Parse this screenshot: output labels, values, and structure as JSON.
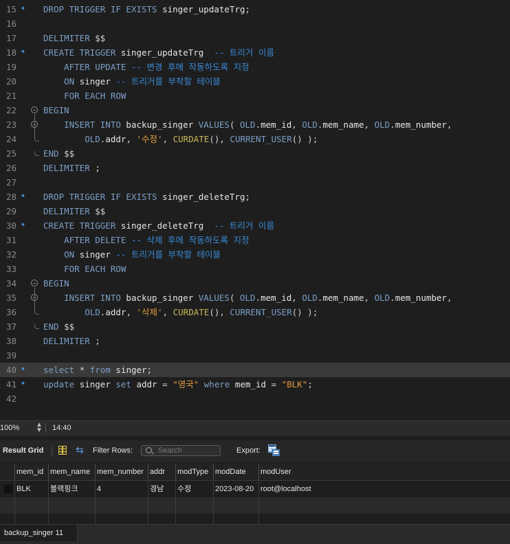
{
  "editor": {
    "lines": [
      {
        "n": "15",
        "dot": true,
        "parts": [
          [
            "kw",
            "DROP TRIGGER IF EXISTS "
          ],
          [
            "id",
            "singer_updateTrg"
          ],
          [
            "op",
            ";"
          ]
        ]
      },
      {
        "n": "16",
        "parts": []
      },
      {
        "n": "17",
        "parts": [
          [
            "kw",
            "DELIMITER "
          ],
          [
            "op",
            "$$"
          ]
        ]
      },
      {
        "n": "18",
        "dot": true,
        "parts": [
          [
            "kw",
            "CREATE TRIGGER "
          ],
          [
            "id",
            "singer_updateTrg  "
          ],
          [
            "cm",
            "-- 트리거 이름"
          ]
        ]
      },
      {
        "n": "19",
        "parts": [
          [
            "kw",
            "    AFTER UPDATE "
          ],
          [
            "cm",
            "-- 변경 후에 작동하도록 지정"
          ]
        ]
      },
      {
        "n": "20",
        "parts": [
          [
            "kw",
            "    ON "
          ],
          [
            "id",
            "singer "
          ],
          [
            "cm",
            "-- 트리거를 부착할 테이블"
          ]
        ]
      },
      {
        "n": "21",
        "parts": [
          [
            "kw",
            "    FOR EACH ROW"
          ]
        ]
      },
      {
        "n": "22",
        "fold": "start",
        "parts": [
          [
            "kw",
            "BEGIN"
          ]
        ]
      },
      {
        "n": "23",
        "fold": "start",
        "parts": [
          [
            "kw",
            "    INSERT INTO "
          ],
          [
            "id",
            "backup_singer "
          ],
          [
            "kw",
            "VALUES"
          ],
          [
            "op",
            "( "
          ],
          [
            "kw",
            "OLD"
          ],
          [
            "op",
            "."
          ],
          [
            "id",
            "mem_id"
          ],
          [
            "op",
            ", "
          ],
          [
            "kw",
            "OLD"
          ],
          [
            "op",
            "."
          ],
          [
            "id",
            "mem_name"
          ],
          [
            "op",
            ", "
          ],
          [
            "kw",
            "OLD"
          ],
          [
            "op",
            "."
          ],
          [
            "id",
            "mem_number"
          ],
          [
            "op",
            ","
          ]
        ]
      },
      {
        "n": "24",
        "fold": "end",
        "parts": [
          [
            "kw",
            "        OLD"
          ],
          [
            "op",
            "."
          ],
          [
            "id",
            "addr"
          ],
          [
            "op",
            ", "
          ],
          [
            "str",
            "'수정'"
          ],
          [
            "op",
            ", "
          ],
          [
            "fn",
            "CURDATE"
          ],
          [
            "op",
            "(), "
          ],
          [
            "kw",
            "CURRENT_USER"
          ],
          [
            "op",
            "() );"
          ]
        ]
      },
      {
        "n": "25",
        "fold": "end",
        "parts": [
          [
            "kw",
            "END "
          ],
          [
            "op",
            "$$"
          ]
        ]
      },
      {
        "n": "26",
        "parts": [
          [
            "kw",
            "DELIMITER "
          ],
          [
            "op",
            ";"
          ]
        ]
      },
      {
        "n": "27",
        "parts": []
      },
      {
        "n": "28",
        "dot": true,
        "parts": [
          [
            "kw",
            "DROP TRIGGER IF EXISTS "
          ],
          [
            "id",
            "singer_deleteTrg"
          ],
          [
            "op",
            ";"
          ]
        ]
      },
      {
        "n": "29",
        "parts": [
          [
            "kw",
            "DELIMITER "
          ],
          [
            "op",
            "$$"
          ]
        ]
      },
      {
        "n": "30",
        "dot": true,
        "parts": [
          [
            "kw",
            "CREATE TRIGGER "
          ],
          [
            "id",
            "singer_deleteTrg  "
          ],
          [
            "cm",
            "-- 트리거 이름"
          ]
        ]
      },
      {
        "n": "31",
        "parts": [
          [
            "kw",
            "    AFTER DELETE "
          ],
          [
            "cm",
            "-- 삭제 후에 작동하도록 지정"
          ]
        ]
      },
      {
        "n": "32",
        "parts": [
          [
            "kw",
            "    ON "
          ],
          [
            "id",
            "singer "
          ],
          [
            "cm",
            "-- 트리거를 부착할 테이블"
          ]
        ]
      },
      {
        "n": "33",
        "parts": [
          [
            "kw",
            "    FOR EACH ROW"
          ]
        ]
      },
      {
        "n": "34",
        "fold": "start",
        "parts": [
          [
            "kw",
            "BEGIN"
          ]
        ]
      },
      {
        "n": "35",
        "fold": "start",
        "parts": [
          [
            "kw",
            "    INSERT INTO "
          ],
          [
            "id",
            "backup_singer "
          ],
          [
            "kw",
            "VALUES"
          ],
          [
            "op",
            "( "
          ],
          [
            "kw",
            "OLD"
          ],
          [
            "op",
            "."
          ],
          [
            "id",
            "mem_id"
          ],
          [
            "op",
            ", "
          ],
          [
            "kw",
            "OLD"
          ],
          [
            "op",
            "."
          ],
          [
            "id",
            "mem_name"
          ],
          [
            "op",
            ", "
          ],
          [
            "kw",
            "OLD"
          ],
          [
            "op",
            "."
          ],
          [
            "id",
            "mem_number"
          ],
          [
            "op",
            ","
          ]
        ]
      },
      {
        "n": "36",
        "fold": "end",
        "parts": [
          [
            "kw",
            "        OLD"
          ],
          [
            "op",
            "."
          ],
          [
            "id",
            "addr"
          ],
          [
            "op",
            ", "
          ],
          [
            "str",
            "'삭제'"
          ],
          [
            "op",
            ", "
          ],
          [
            "fn",
            "CURDATE"
          ],
          [
            "op",
            "(), "
          ],
          [
            "kw",
            "CURRENT_USER"
          ],
          [
            "op",
            "() );"
          ]
        ]
      },
      {
        "n": "37",
        "fold": "end",
        "parts": [
          [
            "kw",
            "END "
          ],
          [
            "op",
            "$$"
          ]
        ]
      },
      {
        "n": "38",
        "parts": [
          [
            "kw",
            "DELIMITER "
          ],
          [
            "op",
            ";"
          ]
        ]
      },
      {
        "n": "39",
        "parts": []
      },
      {
        "n": "40",
        "dot": true,
        "hl": true,
        "parts": [
          [
            "kw",
            "select "
          ],
          [
            "op",
            "* "
          ],
          [
            "kw",
            "from "
          ],
          [
            "id",
            "singer"
          ],
          [
            "op",
            ";"
          ]
        ]
      },
      {
        "n": "41",
        "dot": true,
        "parts": [
          [
            "kw",
            "update "
          ],
          [
            "id",
            "singer "
          ],
          [
            "kw",
            "set "
          ],
          [
            "id",
            "addr "
          ],
          [
            "op",
            "= "
          ],
          [
            "str",
            "\"영국\" "
          ],
          [
            "kw",
            "where "
          ],
          [
            "id",
            "mem_id "
          ],
          [
            "op",
            "= "
          ],
          [
            "str",
            "\"BLK\""
          ],
          [
            "op",
            ";"
          ]
        ]
      },
      {
        "n": "42",
        "parts": []
      }
    ]
  },
  "status": {
    "zoom": "100%",
    "position": "14:40"
  },
  "result_toolbar": {
    "title": "Result Grid",
    "filter_label": "Filter Rows:",
    "search_placeholder": "Search",
    "export_label": "Export:"
  },
  "grid": {
    "columns": [
      "mem_id",
      "mem_name",
      "mem_number",
      "addr",
      "modType",
      "modDate",
      "modUser"
    ],
    "rows": [
      [
        "BLK",
        "블랙핑크",
        "4",
        "경남",
        "수정",
        "2023-08-20",
        "root@localhost"
      ]
    ]
  },
  "tabs": [
    {
      "label": "backup_singer 11"
    }
  ]
}
